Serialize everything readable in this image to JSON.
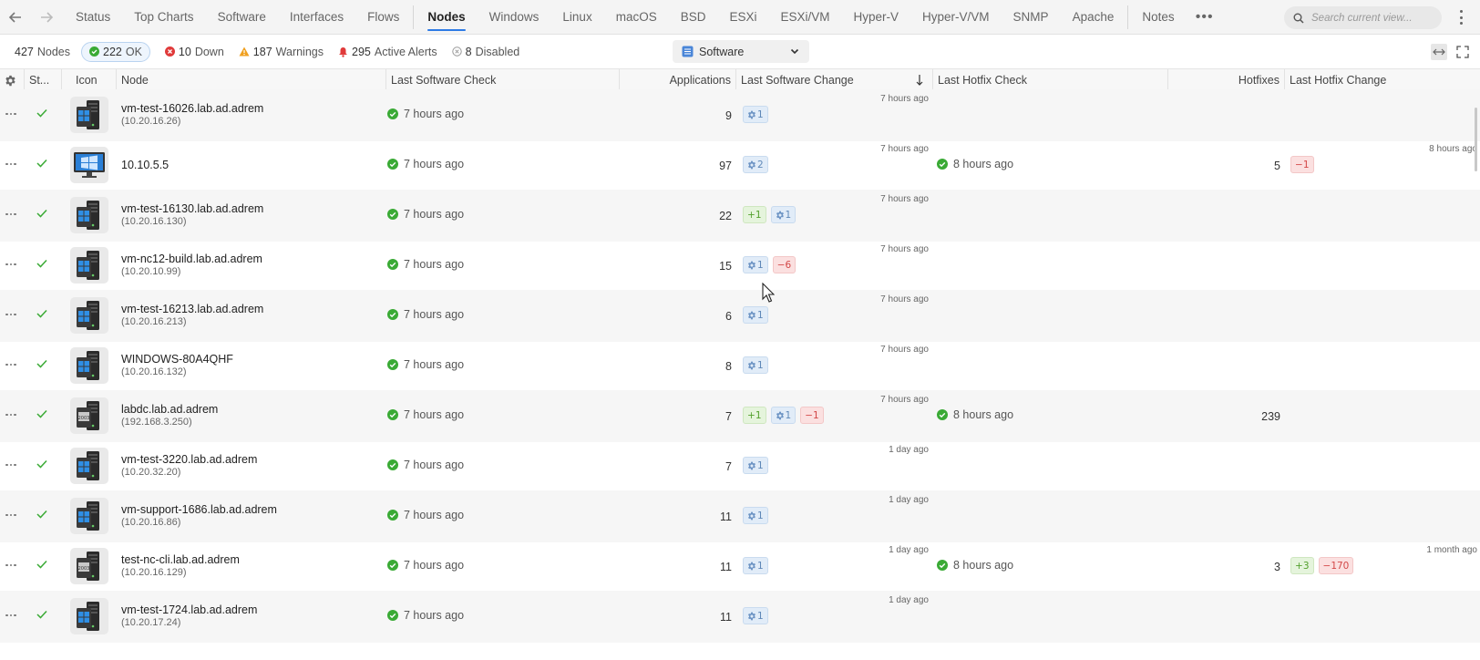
{
  "nav": {
    "tabs": [
      "Status",
      "Top Charts",
      "Software",
      "Interfaces",
      "Flows",
      "Nodes",
      "Windows",
      "Linux",
      "macOS",
      "BSD",
      "ESXi",
      "ESXi/VM",
      "Hyper-V",
      "Hyper-V/VM",
      "SNMP",
      "Apache",
      "Notes"
    ],
    "active_tab": "Nodes",
    "search_placeholder": "Search current view..."
  },
  "status": {
    "nodes_count": "427",
    "nodes_label": "Nodes",
    "ok_count": "222",
    "ok_label": "OK",
    "down_count": "10",
    "down_label": "Down",
    "warnings_count": "187",
    "warnings_label": "Warnings",
    "alerts_count": "295",
    "alerts_label": "Active Alerts",
    "disabled_count": "8",
    "disabled_label": "Disabled",
    "view": "Software"
  },
  "columns": {
    "status": "St...",
    "icon": "Icon",
    "node": "Node",
    "last_sw_check": "Last Software Check",
    "applications": "Applications",
    "last_sw_change": "Last Software Change",
    "last_hf_check": "Last Hotfix Check",
    "hotfixes": "Hotfixes",
    "last_hf_change": "Last Hotfix Change"
  },
  "rows": [
    {
      "name": "vm-test-16026.lab.ad.adrem",
      "ip": "(10.20.16.26)",
      "icon_label": "W",
      "sw_check": "7 hours ago",
      "apps": "9",
      "sw_change": "7 hours ago",
      "add": "",
      "upd": "1",
      "rem": "",
      "hf_check": "",
      "hotfixes": "",
      "hf_add": "",
      "hf_rem": "",
      "hf_change": ""
    },
    {
      "name": "10.10.5.5",
      "ip": "",
      "icon_label": "",
      "sw_check": "7 hours ago",
      "apps": "97",
      "sw_change": "7 hours ago",
      "add": "",
      "upd": "2",
      "rem": "",
      "hf_check": "8 hours ago",
      "hotfixes": "5",
      "hf_add": "",
      "hf_rem": "1",
      "hf_change": "8 hours ago"
    },
    {
      "name": "vm-test-16130.lab.ad.adrem",
      "ip": "(10.20.16.130)",
      "icon_label": "W",
      "sw_check": "7 hours ago",
      "apps": "22",
      "sw_change": "7 hours ago",
      "add": "1",
      "upd": "1",
      "rem": "",
      "hf_check": "",
      "hotfixes": "",
      "hf_add": "",
      "hf_rem": "",
      "hf_change": ""
    },
    {
      "name": "vm-nc12-build.lab.ad.adrem",
      "ip": "(10.20.10.99)",
      "icon_label": "W",
      "sw_check": "7 hours ago",
      "apps": "15",
      "sw_change": "7 hours ago",
      "add": "",
      "upd": "1",
      "rem": "6",
      "hf_check": "",
      "hotfixes": "",
      "hf_add": "",
      "hf_rem": "",
      "hf_change": ""
    },
    {
      "name": "vm-test-16213.lab.ad.adrem",
      "ip": "(10.20.16.213)",
      "icon_label": "W",
      "sw_check": "7 hours ago",
      "apps": "6",
      "sw_change": "7 hours ago",
      "add": "",
      "upd": "1",
      "rem": "",
      "hf_check": "",
      "hotfixes": "",
      "hf_add": "",
      "hf_rem": "",
      "hf_change": ""
    },
    {
      "name": "WINDOWS-80A4QHF",
      "ip": "(10.20.16.132)",
      "icon_label": "W",
      "sw_check": "7 hours ago",
      "apps": "8",
      "sw_change": "7 hours ago",
      "add": "",
      "upd": "1",
      "rem": "",
      "hf_check": "",
      "hotfixes": "",
      "hf_add": "",
      "hf_rem": "",
      "hf_change": ""
    },
    {
      "name": "labdc.lab.ad.adrem",
      "ip": "(192.168.3.250)",
      "icon_label": "2003",
      "sw_check": "7 hours ago",
      "apps": "7",
      "sw_change": "7 hours ago",
      "add": "1",
      "upd": "1",
      "rem": "1",
      "hf_check": "8 hours ago",
      "hotfixes": "239",
      "hf_add": "",
      "hf_rem": "",
      "hf_change": ""
    },
    {
      "name": "vm-test-3220.lab.ad.adrem",
      "ip": "(10.20.32.20)",
      "icon_label": "W",
      "sw_check": "7 hours ago",
      "apps": "7",
      "sw_change": "1 day ago",
      "add": "",
      "upd": "1",
      "rem": "",
      "hf_check": "",
      "hotfixes": "",
      "hf_add": "",
      "hf_rem": "",
      "hf_change": ""
    },
    {
      "name": "vm-support-1686.lab.ad.adrem",
      "ip": "(10.20.16.86)",
      "icon_label": "W",
      "sw_check": "7 hours ago",
      "apps": "11",
      "sw_change": "1 day ago",
      "add": "",
      "upd": "1",
      "rem": "",
      "hf_check": "",
      "hotfixes": "",
      "hf_add": "",
      "hf_rem": "",
      "hf_change": ""
    },
    {
      "name": "test-nc-cli.lab.ad.adrem",
      "ip": "(10.20.16.129)",
      "icon_label": "2003",
      "sw_check": "7 hours ago",
      "apps": "11",
      "sw_change": "1 day ago",
      "add": "",
      "upd": "1",
      "rem": "",
      "hf_check": "8 hours ago",
      "hotfixes": "3",
      "hf_add": "3",
      "hf_rem": "170",
      "hf_change": "1 month ago"
    },
    {
      "name": "vm-test-1724.lab.ad.adrem",
      "ip": "(10.20.17.24)",
      "icon_label": "W",
      "sw_check": "7 hours ago",
      "apps": "11",
      "sw_change": "1 day ago",
      "add": "",
      "upd": "1",
      "rem": "",
      "hf_check": "",
      "hotfixes": "",
      "hf_add": "",
      "hf_rem": "",
      "hf_change": ""
    }
  ],
  "colors": {
    "accent": "#2d7be5",
    "ok": "#3aaa35",
    "down": "#e03a3a",
    "warning": "#f0a020",
    "alert": "#e03a3a"
  }
}
